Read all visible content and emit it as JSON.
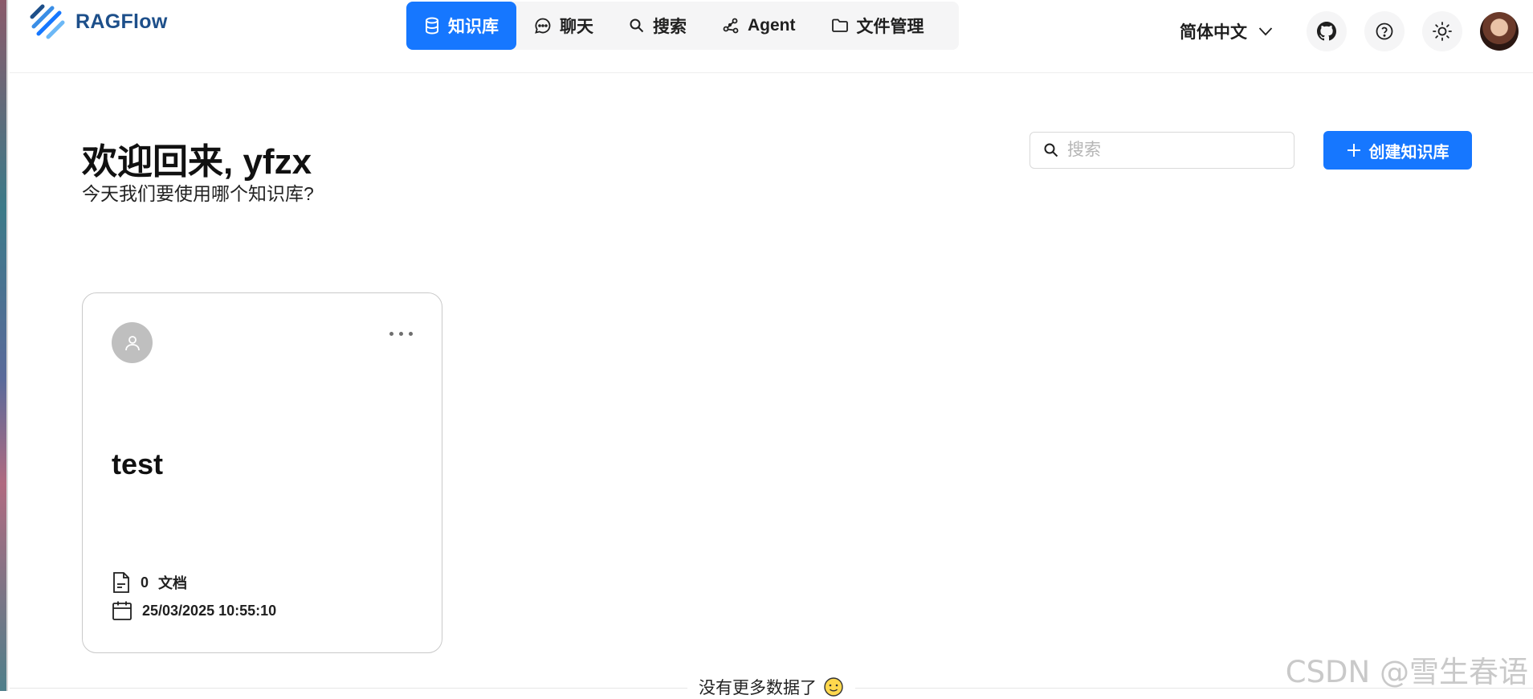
{
  "app": {
    "name": "RAGFlow"
  },
  "nav": [
    {
      "label": "知识库",
      "icon": "database-icon",
      "active": true
    },
    {
      "label": "聊天",
      "icon": "chat-bubble-icon",
      "active": false
    },
    {
      "label": "搜索",
      "icon": "search-icon",
      "active": false
    },
    {
      "label": "Agent",
      "icon": "graph-nodes-icon",
      "active": false
    },
    {
      "label": "文件管理",
      "icon": "folder-icon",
      "active": false
    }
  ],
  "header": {
    "language": "简体中文"
  },
  "welcome": {
    "title": "欢迎回来, yfzx",
    "subtitle": "今天我们要使用哪个知识库?"
  },
  "search": {
    "placeholder": "搜索",
    "value": ""
  },
  "create_button": {
    "label": "创建知识库"
  },
  "knowledge_bases": [
    {
      "name": "test",
      "doc_count": "0",
      "doc_label": "文档",
      "created": "25/03/2025 10:55:10"
    }
  ],
  "footer": {
    "no_more": "没有更多数据了",
    "watermark": "CSDN @雪生春语"
  },
  "colors": {
    "accent": "#1677ff",
    "brand": "#1d4f8a"
  }
}
